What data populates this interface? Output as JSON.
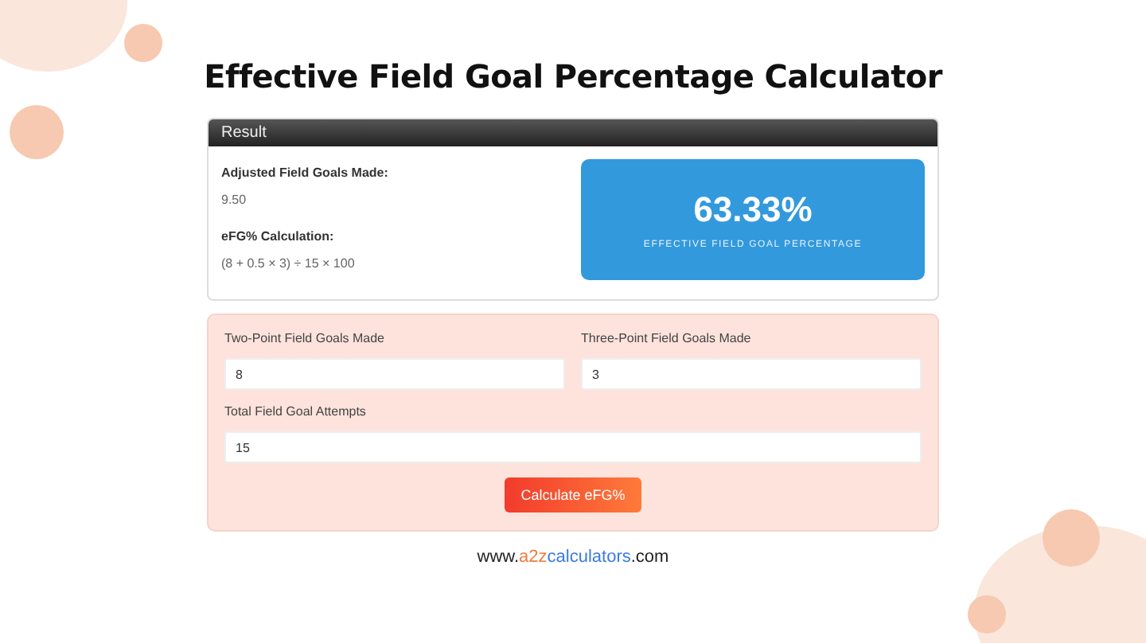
{
  "title": "Effective Field Goal Percentage Calculator",
  "result": {
    "header": "Result",
    "details": [
      {
        "label": "Adjusted Field Goals Made:",
        "value": "9.50"
      },
      {
        "label": "eFG% Calculation:",
        "value": "(8 + 0.5 × 3) ÷ 15 × 100"
      }
    ],
    "big_value": "63.33%",
    "big_caption": "EFFECTIVE FIELD GOAL PERCENTAGE"
  },
  "fields": [
    {
      "label": "Two-Point Field Goals Made",
      "value": "8"
    },
    {
      "label": "Three-Point Field Goals Made",
      "value": "3"
    },
    {
      "label": "Total Field Goal Attempts",
      "value": "15"
    }
  ],
  "button": "Calculate eFG%",
  "footer": [
    {
      "text": "www.",
      "color": "#222222"
    },
    {
      "text": "a2z",
      "color": "#f07a3a"
    },
    {
      "text": "calculators",
      "color": "#3a7be0"
    },
    {
      "text": ".com",
      "color": "#222222"
    }
  ]
}
